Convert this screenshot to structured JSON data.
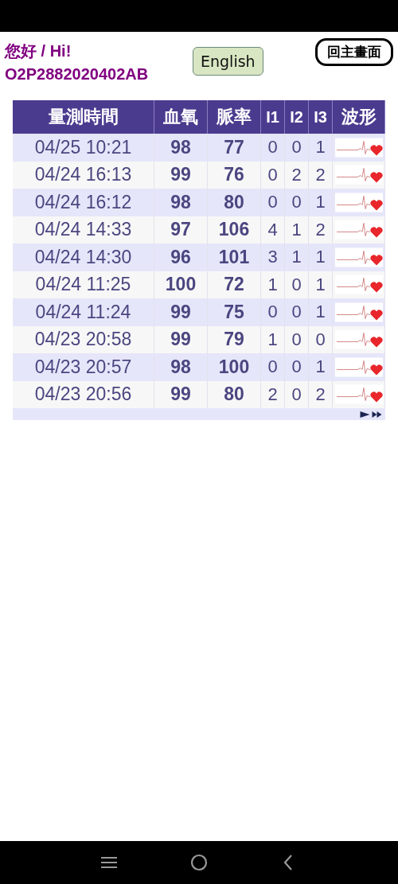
{
  "greeting": "您好 / Hi!",
  "device_id": "O2P2882020402AB",
  "language_button": "English",
  "home_button": "回主畫面",
  "table": {
    "columns": [
      "量測時間",
      "血氧",
      "脈率",
      "I1",
      "I2",
      "I3",
      "波形"
    ],
    "rows": [
      {
        "time": "04/25 10:21",
        "spo2": "98",
        "pulse": "77",
        "i1": "0",
        "i2": "0",
        "i3": "1"
      },
      {
        "time": "04/24 16:13",
        "spo2": "99",
        "pulse": "76",
        "i1": "0",
        "i2": "2",
        "i3": "2"
      },
      {
        "time": "04/24 16:12",
        "spo2": "98",
        "pulse": "80",
        "i1": "0",
        "i2": "0",
        "i3": "1"
      },
      {
        "time": "04/24 14:33",
        "spo2": "97",
        "pulse": "106",
        "i1": "4",
        "i2": "1",
        "i3": "2"
      },
      {
        "time": "04/24 14:30",
        "spo2": "96",
        "pulse": "101",
        "i1": "3",
        "i2": "1",
        "i3": "1"
      },
      {
        "time": "04/24 11:25",
        "spo2": "100",
        "pulse": "72",
        "i1": "1",
        "i2": "0",
        "i3": "1"
      },
      {
        "time": "04/24 11:24",
        "spo2": "99",
        "pulse": "75",
        "i1": "0",
        "i2": "0",
        "i3": "1"
      },
      {
        "time": "04/23 20:58",
        "spo2": "99",
        "pulse": "79",
        "i1": "1",
        "i2": "0",
        "i3": "0"
      },
      {
        "time": "04/23 20:57",
        "spo2": "98",
        "pulse": "100",
        "i1": "0",
        "i2": "0",
        "i3": "1"
      },
      {
        "time": "04/23 20:56",
        "spo2": "99",
        "pulse": "80",
        "i1": "2",
        "i2": "0",
        "i3": "2"
      }
    ]
  }
}
